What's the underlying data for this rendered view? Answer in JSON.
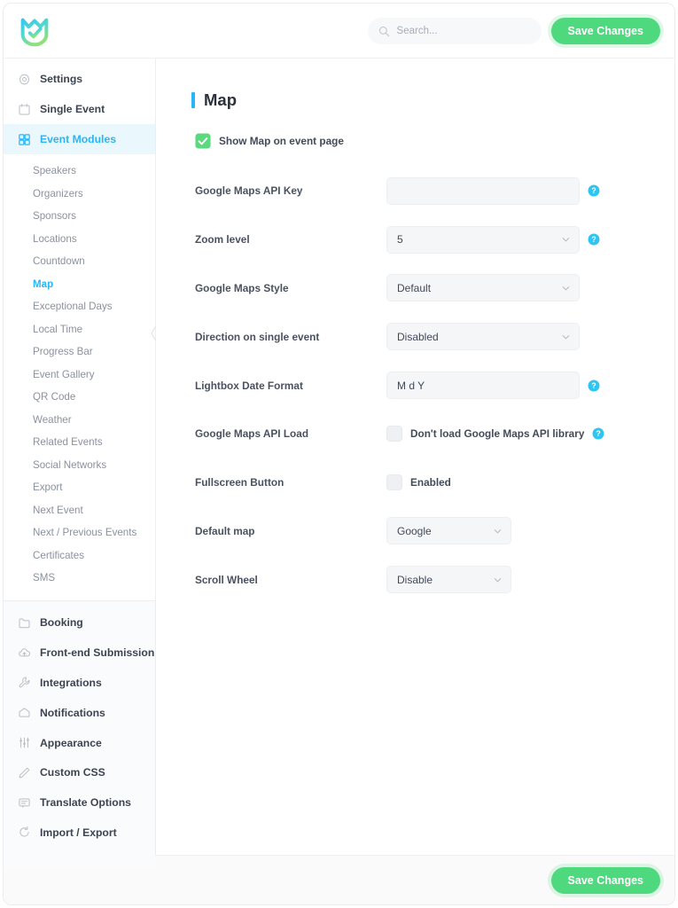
{
  "header": {
    "logo_alt": "app-logo",
    "search": {
      "placeholder": "Search...",
      "value": ""
    },
    "save_label": "Save Changes"
  },
  "sidebar": {
    "top_items": [
      {
        "label": "Settings",
        "icon": "gear-icon",
        "active": false
      },
      {
        "label": "Single Event",
        "icon": "calendar-icon",
        "active": false
      },
      {
        "label": "Event Modules",
        "icon": "grid-icon",
        "active": true
      }
    ],
    "submenu": [
      {
        "label": "Speakers",
        "active": false
      },
      {
        "label": "Organizers",
        "active": false
      },
      {
        "label": "Sponsors",
        "active": false
      },
      {
        "label": "Locations",
        "active": false
      },
      {
        "label": "Countdown",
        "active": false
      },
      {
        "label": "Map",
        "active": true
      },
      {
        "label": "Exceptional Days",
        "active": false
      },
      {
        "label": "Local Time",
        "active": false
      },
      {
        "label": "Progress Bar",
        "active": false
      },
      {
        "label": "Event Gallery",
        "active": false
      },
      {
        "label": "QR Code",
        "active": false
      },
      {
        "label": "Weather",
        "active": false
      },
      {
        "label": "Related Events",
        "active": false
      },
      {
        "label": "Social Networks",
        "active": false
      },
      {
        "label": "Export",
        "active": false
      },
      {
        "label": "Next Event",
        "active": false
      },
      {
        "label": "Next / Previous Events",
        "active": false
      },
      {
        "label": "Certificates",
        "active": false
      },
      {
        "label": "SMS",
        "active": false
      }
    ],
    "bottom_items": [
      {
        "label": "Booking",
        "icon": "wallet-icon"
      },
      {
        "label": "Front-end Submission",
        "icon": "cloud-upload-icon"
      },
      {
        "label": "Integrations",
        "icon": "wrench-icon"
      },
      {
        "label": "Notifications",
        "icon": "envelope-icon"
      },
      {
        "label": "Appearance",
        "icon": "sliders-icon"
      },
      {
        "label": "Custom CSS",
        "icon": "pencil-icon"
      },
      {
        "label": "Translate Options",
        "icon": "chat-icon"
      },
      {
        "label": "Import / Export",
        "icon": "refresh-icon"
      }
    ]
  },
  "main": {
    "title": "Map",
    "show_map": {
      "label": "Show Map on event page",
      "checked": true
    },
    "fields": [
      {
        "label": "Google Maps API Key",
        "type": "text",
        "value": "",
        "placeholder": "",
        "help": true
      },
      {
        "label": "Zoom level",
        "type": "select",
        "value": "5",
        "help": true
      },
      {
        "label": "Google Maps Style",
        "type": "select",
        "value": "Default",
        "help": false
      },
      {
        "label": "Direction on single event",
        "type": "select",
        "value": "Disabled",
        "help": false
      },
      {
        "label": "Lightbox Date Format",
        "type": "text",
        "value": "M d Y",
        "placeholder": "",
        "help": true
      },
      {
        "label": "Google Maps API Load",
        "type": "checkbox",
        "checkbox_label": "Don't load Google Maps API library",
        "checked": false,
        "help": true
      },
      {
        "label": "Fullscreen Button",
        "type": "checkbox",
        "checkbox_label": "Enabled",
        "checked": false,
        "help": false
      },
      {
        "label": "Default map",
        "type": "select-narrow",
        "value": "Google",
        "help": false
      },
      {
        "label": "Scroll Wheel",
        "type": "select-narrow",
        "value": "Disable",
        "help": false
      }
    ]
  },
  "footer": {
    "save_label": "Save Changes"
  },
  "colors": {
    "accent": "#29b6f6",
    "save_green": "#4fd97f",
    "check_green": "#5bd97e",
    "help_cyan": "#2ec5f3",
    "sidebar_active_bg": "#eaf7fd"
  }
}
